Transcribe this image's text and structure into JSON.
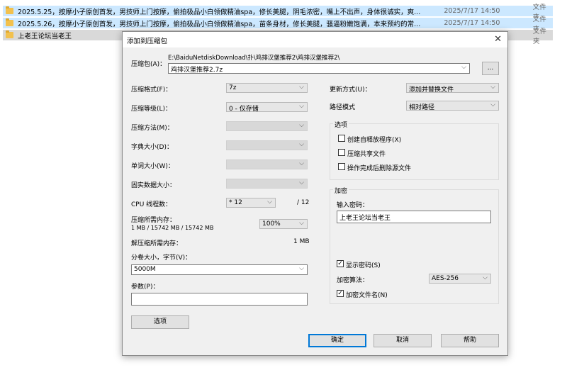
{
  "files": [
    {
      "name": "2025.5.25，按摩小子原创首发，男技师上门按摩，偷拍极品小白领做精油spa，修长美腿，阴毛浓密，嘴上不出声，身体很诚实，爽...",
      "date": "2025/7/17 14:50",
      "type": "文件夹"
    },
    {
      "name": "2025.5.26，按摩小子原创首发，男技师上门按摩，偷拍极品小白领做精油spa，苗条身材，修长美腿，骚逼粉嫩饱满，本来预约的常...",
      "date": "2025/7/17 14:50",
      "type": "文件夹"
    },
    {
      "name": "上老王论坛当老王",
      "date": "",
      "type": "文件夹"
    }
  ],
  "dialog": {
    "title": "添加到压缩包",
    "archive_label": "压缩包(A)：",
    "archive_path": "E:\\BaiduNetdiskDownload\\扑\\鸡排汉堡推荐2\\鸡排汉堡推荐2\\",
    "archive_name": "鸡排汉堡推荐2.7z",
    "browse": "...",
    "format_label": "压缩格式(F)：",
    "format_value": "7z",
    "level_label": "压缩等级(L)：",
    "level_value": "0 - 仅存储",
    "method_label": "压缩方法(M)：",
    "dict_label": "字典大小(D)：",
    "word_label": "单词大小(W)：",
    "solid_label": "固实数据大小：",
    "threads_label": "CPU 线程数：",
    "threads_value": "* 12",
    "threads_max": "/ 12",
    "mem_comp_label": "压缩所需内存：",
    "mem_comp_value": "1 MB / 15742 MB / 15742 MB",
    "mem_percent": "100%",
    "mem_decomp_label": "解压缩所需内存：",
    "mem_decomp_value": "1 MB",
    "volume_label": "分卷大小，字节(V)：",
    "volume_value": "5000M",
    "params_label": "参数(P)：",
    "params_value": "",
    "options_button": "选项",
    "update_label": "更新方式(U)：",
    "update_value": "添加并替换文件",
    "path_label": "路径模式",
    "path_value": "相对路径",
    "options_group": "选项",
    "opt_sfx": "创建自释放程序(X)",
    "opt_shared": "压缩共享文件",
    "opt_delete": "操作完成后删除源文件",
    "encrypt_group": "加密",
    "password_label": "输入密码：",
    "password_value": "上老王论坛当老王",
    "show_password": "显示密码(S)",
    "algo_label": "加密算法：",
    "algo_value": "AES-256",
    "encrypt_names": "加密文件名(N)",
    "ok": "确定",
    "cancel": "取消",
    "help": "帮助"
  }
}
